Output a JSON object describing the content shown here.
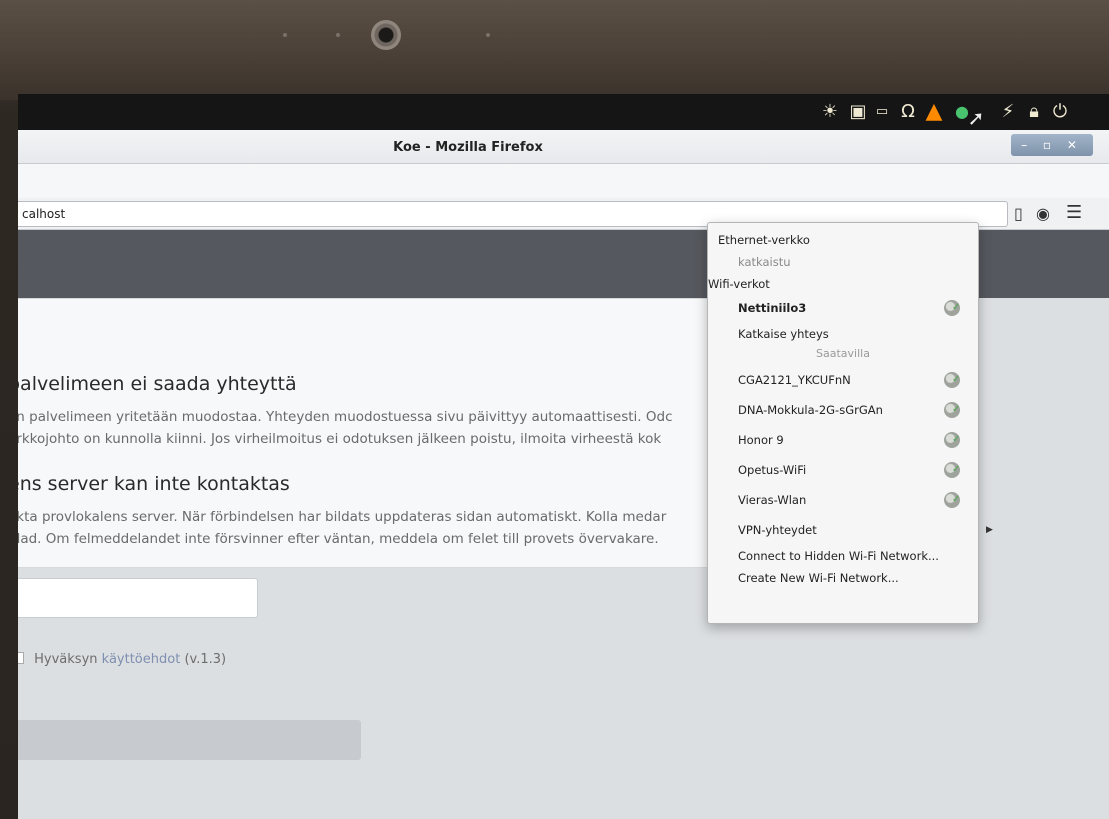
{
  "window": {
    "title": "Koe - Mozilla Firefox",
    "controls": "– ▫ ✕"
  },
  "address_bar": {
    "url": "calhost"
  },
  "toolbar": {
    "menu_icon": "☰",
    "btn1_icon": "▯",
    "btn2_icon": "◉"
  },
  "page": {
    "heading_fi": "palvelimeen ei saada yhteyttä",
    "text_fi_1": "an palvelimeen yritetään muodostaa. Yhteyden muodostuessa sivu päivittyy automaattisesti. Odc",
    "text_fi_2": "erkkojohto on kunnolla kiinni. Jos virheilmoitus ei odotuksen jälkeen poistu, ilmoita virheestä kok",
    "heading_sv": "ens server kan inte kontaktas",
    "text_sv_1": "akta provlokalens server. När förbindelsen har bildats uppdateras sidan automatiskt. Kolla medar",
    "text_sv_2": "plad. Om felmeddelandet inte försvinner efter väntan, meddela om felet till provets övervakare.",
    "terms_label": "Hyväksyn",
    "terms_link": "käyttöehdot",
    "terms_version": "(v.1.3)"
  },
  "network_menu": {
    "ethernet_header": "Ethernet-verkko",
    "ethernet_status": "katkaistu",
    "wifi_header": "Wifi-verkot",
    "connected_network": "Nettiniilo3",
    "disconnect": "Katkaise yhteys",
    "available_label": "Saatavilla",
    "networks": [
      "CGA2121_YKCUFnN",
      "DNA-Mokkula-2G-sGrGAn",
      "Honor 9",
      "Opetus-WiFi",
      "Vieras-Wlan"
    ],
    "vpn": "VPN-yhteydet",
    "hidden": "Connect to Hidden Wi-Fi Network...",
    "create": "Create New Wi-Fi Network..."
  },
  "tray": {
    "icons": [
      "sun-icon",
      "camera-icon",
      "battery-icon",
      "headphones-icon",
      "warning-icon",
      "network-icon",
      "power-plug-icon",
      "lock-icon",
      "power-icon"
    ]
  },
  "colors": {
    "warning": "#ff8a00",
    "network_active": "#48c36e",
    "panel": "#151515"
  }
}
